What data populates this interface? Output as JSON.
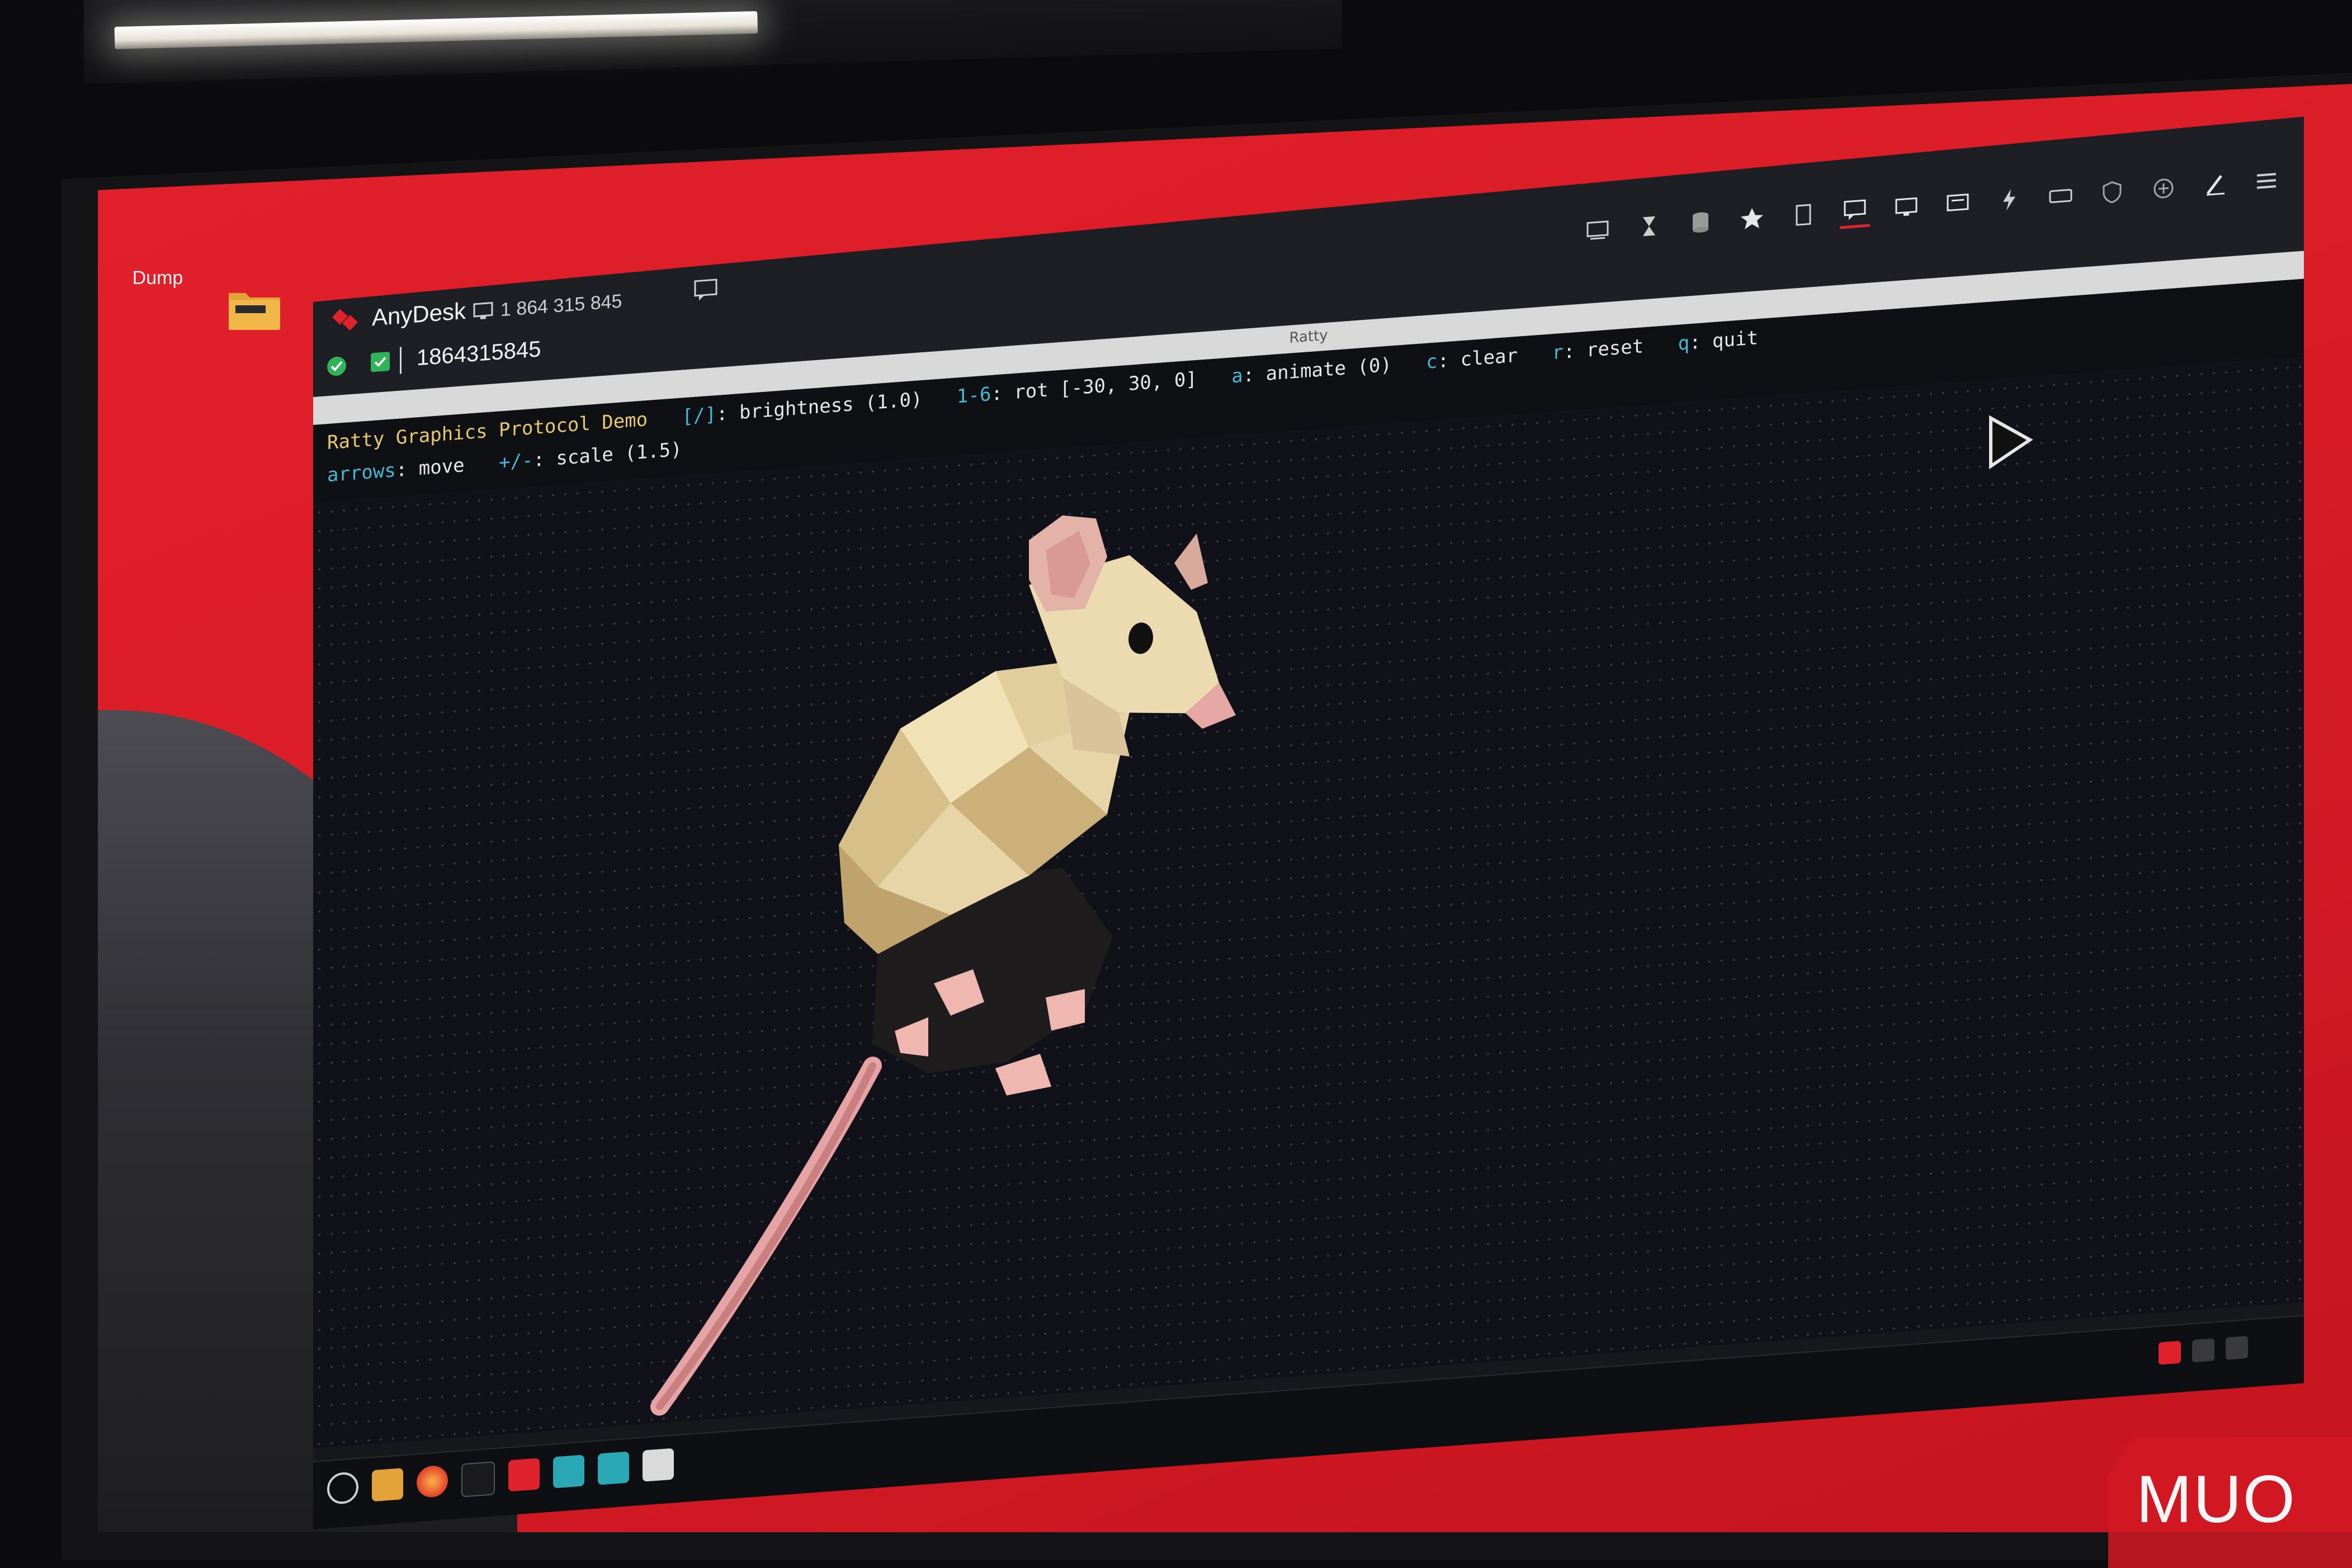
{
  "desktop": {
    "icons": [
      {
        "label": "Dump",
        "icon": "folder-icon"
      }
    ]
  },
  "anydesk": {
    "app_name": "AnyDesk",
    "session_id_display": "1 864 315 845",
    "address_bar_value": "1864315845",
    "toolbar_icons": [
      "display-settings-icon",
      "hourglass-icon",
      "database-icon",
      "star-icon",
      "file-icon",
      "chat-icon",
      "monitor-icon",
      "screen-share-icon",
      "lightning-icon",
      "keyboard-icon",
      "shield-icon",
      "plus-icon",
      "pen-icon",
      "menu-icon"
    ],
    "window_controls": [
      "minimize",
      "maximize",
      "close"
    ]
  },
  "terminal": {
    "window_title": "Ratty",
    "help": {
      "title": "Ratty Graphics Protocol Demo",
      "line1": [
        {
          "key": "[/]",
          "desc": ": brightness (1.0)"
        },
        {
          "key": "1-6",
          "desc": ": rot [-30, 30, 0]"
        },
        {
          "key": "a",
          "desc": ": animate (0)"
        },
        {
          "key": "c",
          "desc": ": clear"
        },
        {
          "key": "r",
          "desc": ": reset"
        },
        {
          "key": "q",
          "desc": ": quit"
        }
      ],
      "line2": [
        {
          "key": "arrows",
          "desc": ": move"
        },
        {
          "key": "+/-",
          "desc": ": scale (1.5)"
        }
      ]
    },
    "render": {
      "subject": "low-poly-mouse-icon"
    }
  },
  "taskbar": {
    "apps": [
      "menu-icon",
      "files-icon",
      "firefox-icon",
      "terminal-icon",
      "anydesk-icon",
      "system-monitor-icon",
      "system-monitor-2-icon",
      "settings-icon"
    ]
  },
  "watermark": {
    "text": "MUO"
  },
  "colors": {
    "desktop_red": "#e1202a",
    "terminal_bg": "#111219",
    "help_key": "#46b8d6",
    "help_title": "#e7c96c",
    "anydesk_red": "#e0222c"
  }
}
